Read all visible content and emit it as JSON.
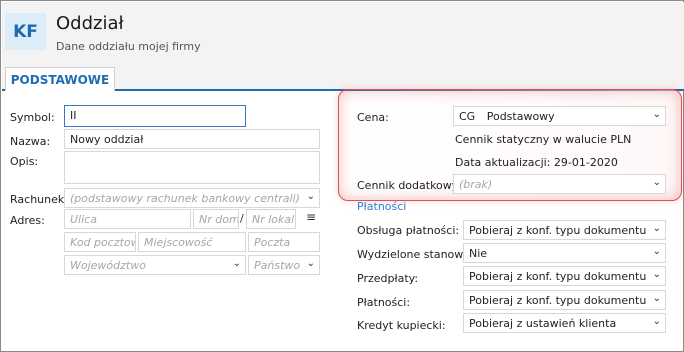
{
  "header": {
    "logo": "KF",
    "title": "Oddział",
    "subtitle": "Dane oddziału mojej firmy"
  },
  "tabs": [
    {
      "label": "PODSTAWOWE"
    }
  ],
  "left": {
    "symbol": {
      "label": "Symbol:",
      "value": "II"
    },
    "nazwa": {
      "label": "Nazwa:",
      "value": "Nowy oddział"
    },
    "opis": {
      "label": "Opis:",
      "value": ""
    },
    "rachunek": {
      "label": "Rachunek:",
      "placeholder": "(podstawowy rachunek bankowy centrali)"
    },
    "adres": {
      "label": "Adres:",
      "ulica": "Ulica",
      "nr_domu": "Nr domu",
      "separator": "/",
      "nr_lokalu": "Nr lokalu",
      "kod": "Kod pocztowy",
      "miejscowosc": "Miejscowość",
      "poczta": "Poczta",
      "wojewodztwo": "Województwo",
      "panstwo": "Państwo"
    }
  },
  "right": {
    "cena": {
      "label": "Cena:",
      "code": "CG",
      "value": "Podstawowy"
    },
    "cennik_info": "Cennik statyczny w walucie PLN",
    "data_aktualizacji": "Data aktualizacji: 29-01-2020",
    "cennik_dodatkowy": {
      "label": "Cennik dodatkowy:",
      "placeholder": "(brak)"
    },
    "platnosci_section": "Płatności",
    "rows": [
      {
        "label": "Obsługa płatności:",
        "value": "Pobieraj z konf. typu dokumentu"
      },
      {
        "label": "Wydzielone stanow...",
        "value": "Nie"
      },
      {
        "label": "Przedpłaty:",
        "value": "Pobieraj z konf. typu dokumentu"
      },
      {
        "label": "Płatności:",
        "value": "Pobieraj z konf. typu dokumentu"
      },
      {
        "label": "Kredyt kupiecki:",
        "value": "Pobieraj z ustawień klienta"
      }
    ]
  },
  "colors": {
    "accent": "#1f6bb0",
    "highlight": "#e05050",
    "link": "#2f7fd0"
  }
}
